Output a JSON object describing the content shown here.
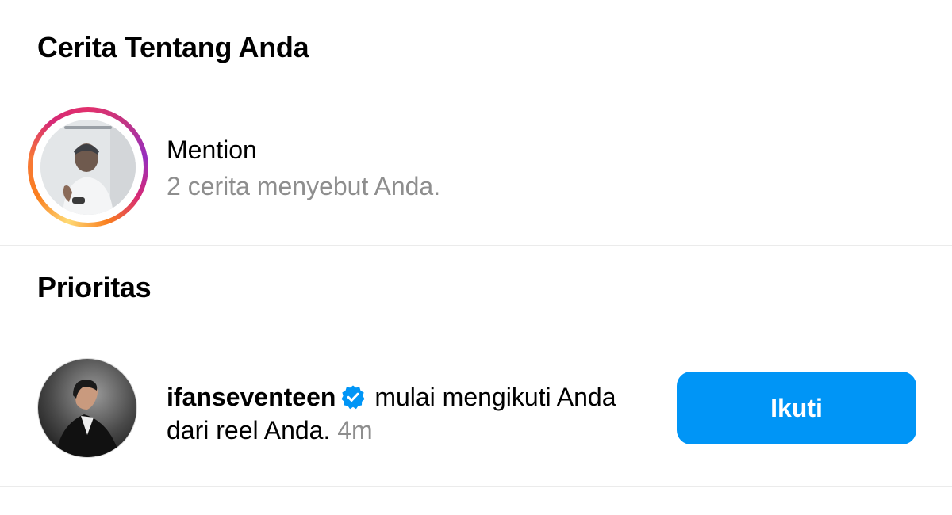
{
  "stories_section": {
    "title": "Cerita Tentang Anda",
    "mention_title": "Mention",
    "mention_subtitle": "2 cerita menyebut Anda.",
    "story_ring_icon": "story-ring"
  },
  "priority_section": {
    "title": "Prioritas",
    "notification": {
      "username": "ifanseventeen",
      "verified_icon": "verified-badge-icon",
      "action_text": " mulai mengikuti Anda dari reel Anda. ",
      "time": "4m"
    },
    "follow_button_label": "Ikuti"
  },
  "colors": {
    "accent_blue": "#0095f6",
    "secondary_text": "#8e8e8e",
    "divider": "#ebebeb"
  }
}
